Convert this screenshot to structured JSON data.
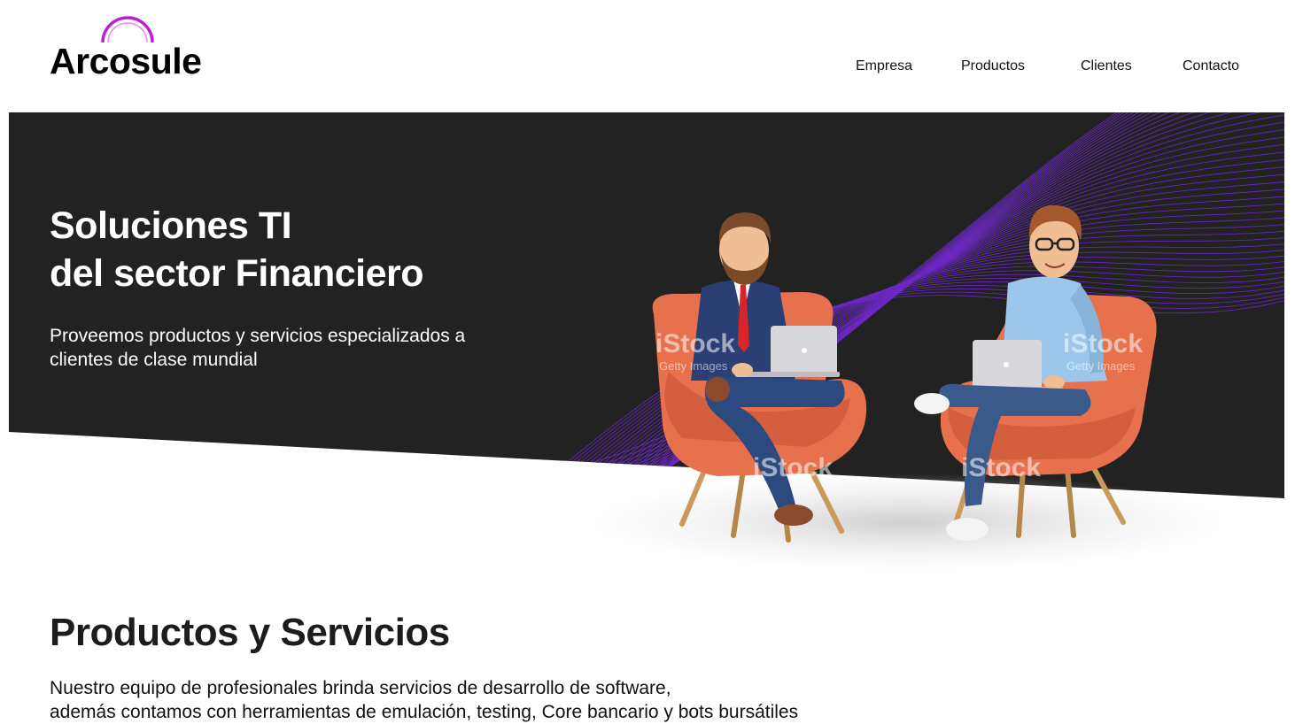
{
  "brand": {
    "name": "Arcosule",
    "accent": "#c01cd6"
  },
  "nav": {
    "items": [
      {
        "label": "Empresa"
      },
      {
        "label": "Productos"
      },
      {
        "label": "Clientes"
      },
      {
        "label": "Contacto"
      }
    ]
  },
  "hero": {
    "title_line1": "Soluciones TI",
    "title_line2": "del sector Financiero",
    "subtitle_line1": "Proveemos productos y servicios especializados a",
    "subtitle_line2": "clientes de clase mundial",
    "background": "#222222",
    "wave_color": "#7a2ae0",
    "watermark": "iStock",
    "watermark_sub": "Getty Images"
  },
  "section": {
    "title": "Productos y Servicios",
    "text_line1": "Nuestro equipo de profesionales brinda servicios de desarrollo de software,",
    "text_line2": "además contamos con herramientas de emulación, testing, Core bancario y bots bursátiles"
  }
}
